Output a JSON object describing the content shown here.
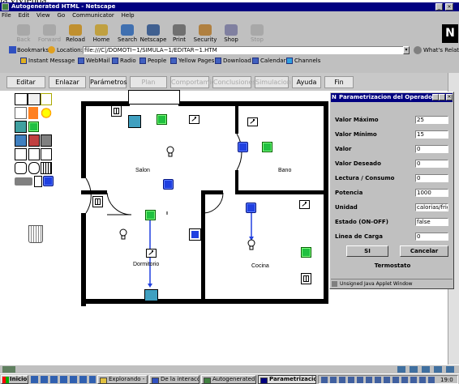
{
  "browser": {
    "title": "Autogenerated HTML - Netscape",
    "menu": [
      "File",
      "Edit",
      "View",
      "Go",
      "Communicator",
      "Help"
    ],
    "toolbar": [
      {
        "label": "Back",
        "icon": "back-arrow-icon",
        "disabled": true
      },
      {
        "label": "Forward",
        "icon": "forward-arrow-icon",
        "disabled": true
      },
      {
        "label": "Reload",
        "icon": "reload-icon",
        "disabled": false
      },
      {
        "label": "Home",
        "icon": "home-icon",
        "disabled": false
      },
      {
        "label": "Search",
        "icon": "search-icon",
        "disabled": false
      },
      {
        "label": "Netscape",
        "icon": "netscape-icon",
        "disabled": false
      },
      {
        "label": "Print",
        "icon": "print-icon",
        "disabled": false
      },
      {
        "label": "Security",
        "icon": "lock-icon",
        "disabled": false
      },
      {
        "label": "Shop",
        "icon": "shop-icon",
        "disabled": false
      },
      {
        "label": "Stop",
        "icon": "stop-icon",
        "disabled": true
      }
    ],
    "bookmarks_label": "Bookmarks",
    "location_label": "Location:",
    "url": "file:///C|/DOMOTI~1/SIMULA~1/EDITAR~1.HTM",
    "whats_related": "What's Related",
    "personal": [
      "Instant Message",
      "WebMail",
      "Radio",
      "People",
      "Yellow Pages",
      "Download",
      "Calendar",
      "Channels"
    ]
  },
  "applet": {
    "buttons": [
      {
        "label": "Editar",
        "disabled": false
      },
      {
        "label": "Enlazar",
        "disabled": false
      },
      {
        "label": "Parámetros",
        "disabled": false
      },
      {
        "label": "Plan",
        "disabled": true
      },
      {
        "label": "Comportamiento",
        "disabled": true
      },
      {
        "label": "Conclusiones",
        "disabled": true
      },
      {
        "label": "Simulacion",
        "disabled": true
      },
      {
        "label": "Ayuda",
        "disabled": false
      },
      {
        "label": "Fin",
        "disabled": false
      }
    ],
    "rooms": {
      "salon": "Salon",
      "bano": "Bano",
      "dormitorio": "Dormitorio",
      "cocina": "Cocina"
    }
  },
  "dialog": {
    "title": "Parametrizacion del Operador",
    "fields": [
      {
        "label": "Valor Máximo",
        "value": "25"
      },
      {
        "label": "Valor Mínimo",
        "value": "15"
      },
      {
        "label": "Valor",
        "value": "0"
      },
      {
        "label": "Valor Deseado",
        "value": "0"
      },
      {
        "label": "Lectura / Consumo",
        "value": "0"
      },
      {
        "label": "Potencia",
        "value": "1000"
      },
      {
        "label": "Unidad",
        "value": "calorias/frigor"
      },
      {
        "label": "Estado (ON-OFF)",
        "value": "false"
      },
      {
        "label": "Linea de Carga",
        "value": "0"
      }
    ],
    "ok_label": "SI",
    "cancel_label": "Cancelar",
    "device_name": "Termostato",
    "status": "Unsigned Java Applet Window"
  },
  "taskbar": {
    "start": "Inicio",
    "tasks": [
      "Explorando - simulador",
      "De la interacción direct...",
      "Autogenerated HTML -...",
      "Parametrizacion d..."
    ],
    "clock": "19:0"
  },
  "colors": {
    "titlebar": "#000080",
    "accent_blue": "#2040e0",
    "accent_green": "#20c040"
  }
}
